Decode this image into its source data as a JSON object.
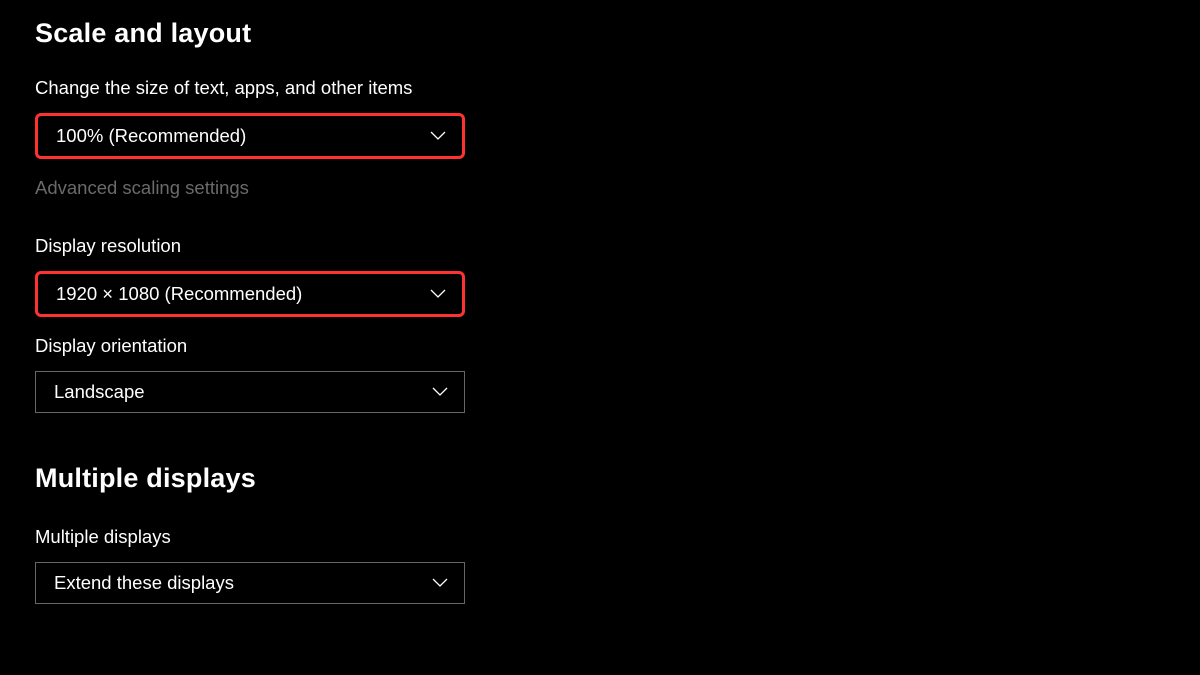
{
  "sections": {
    "scale_layout": {
      "heading": "Scale and layout",
      "text_size": {
        "label": "Change the size of text, apps, and other items",
        "value": "100% (Recommended)"
      },
      "advanced_link": "Advanced scaling settings",
      "resolution": {
        "label": "Display resolution",
        "value": "1920 × 1080 (Recommended)"
      },
      "orientation": {
        "label": "Display orientation",
        "value": "Landscape"
      }
    },
    "multiple_displays": {
      "heading": "Multiple displays",
      "mode": {
        "label": "Multiple displays",
        "value": "Extend these displays"
      }
    }
  },
  "colors": {
    "highlight": "#ff3232",
    "background": "#000000",
    "text": "#ffffff",
    "muted": "#6a6a6a",
    "border": "#666666"
  }
}
